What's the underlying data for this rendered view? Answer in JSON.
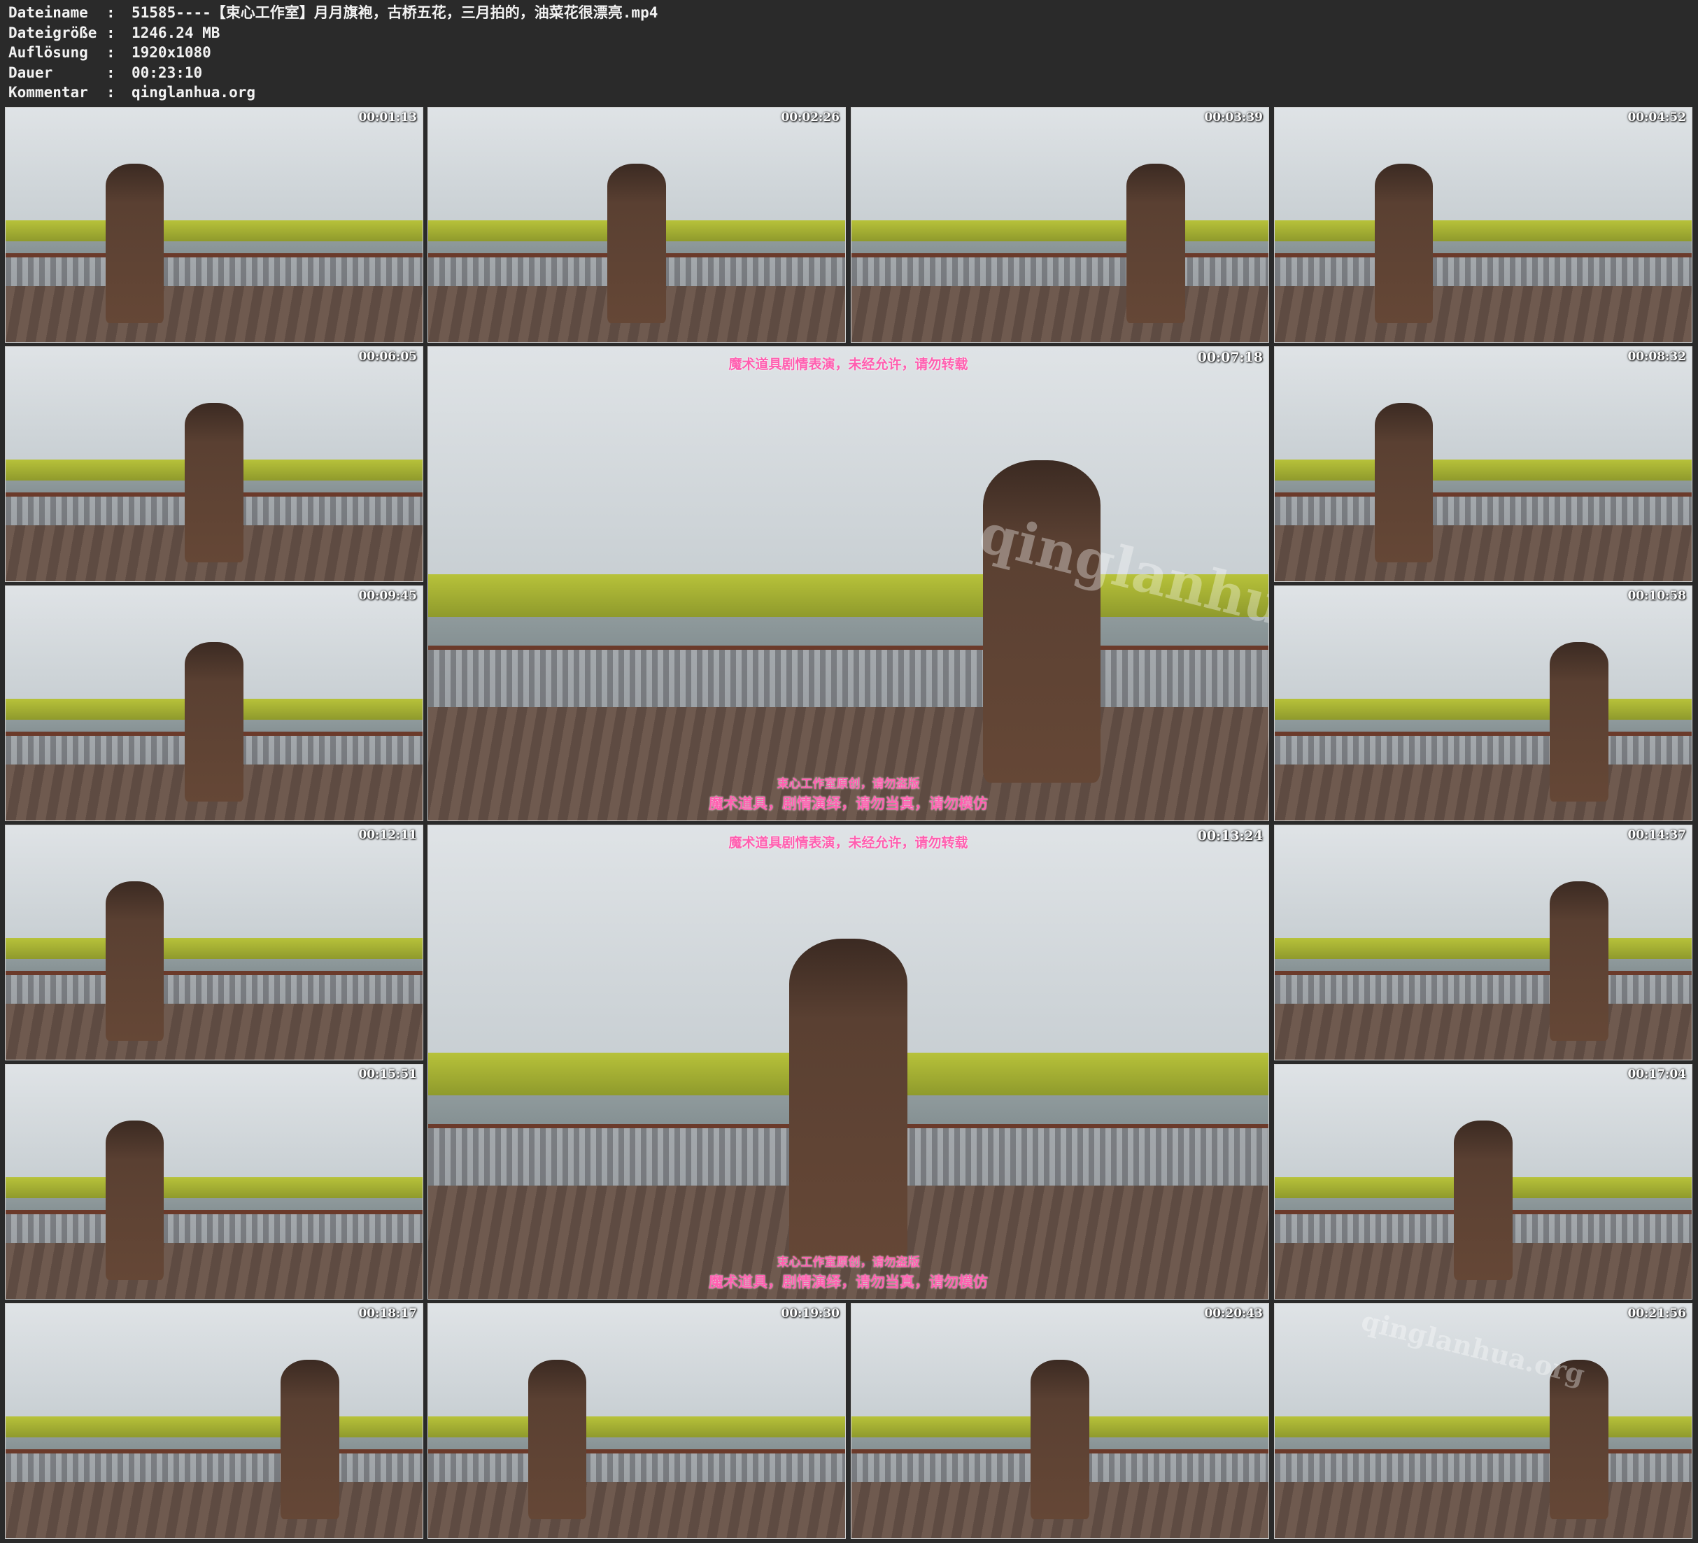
{
  "info": {
    "rows": [
      {
        "label": "Dateiname",
        "value": "51585----【束心工作室】月月旗袍，古桥五花，三月拍的，油菜花很漂亮.mp4"
      },
      {
        "label": "Dateigröße",
        "value": "1246.24 MB"
      },
      {
        "label": "Auflösung",
        "value": "1920x1080"
      },
      {
        "label": "Dauer",
        "value": "00:23:10"
      },
      {
        "label": "Kommentar",
        "value": "qinglanhua.org"
      }
    ],
    "separator": ":"
  },
  "thumbnails": [
    {
      "timecode": "00:01:13"
    },
    {
      "timecode": "00:02:26"
    },
    {
      "timecode": "00:03:39"
    },
    {
      "timecode": "00:04:52"
    },
    {
      "timecode": "00:06:05"
    },
    {
      "timecode": "00:07:18",
      "wm_top": "魔术道具剧情表演，未经允许，请勿转载",
      "wm_mid": "束心工作室原创，请勿盗版",
      "wm_bot": "魔术道具，剧情演绎，请勿当真，请勿模仿",
      "site": "qinglanhua.net"
    },
    {
      "timecode": "00:08:32"
    },
    {
      "timecode": "00:09:45"
    },
    {
      "timecode": "00:10:58"
    },
    {
      "timecode": "00:12:11"
    },
    {
      "timecode": "00:13:24",
      "wm_top": "魔术道具剧情表演，未经允许，请勿转载",
      "wm_mid": "束心工作室原创，请勿盗版",
      "wm_bot": "魔术道具，剧情演绎，请勿当真，请勿模仿"
    },
    {
      "timecode": "00:14:37"
    },
    {
      "timecode": "00:15:51"
    },
    {
      "timecode": "00:17:04"
    },
    {
      "timecode": "00:18:17"
    },
    {
      "timecode": "00:19:30"
    },
    {
      "timecode": "00:20:43"
    },
    {
      "timecode": "00:21:56",
      "site": "qinglanhua.org"
    }
  ]
}
